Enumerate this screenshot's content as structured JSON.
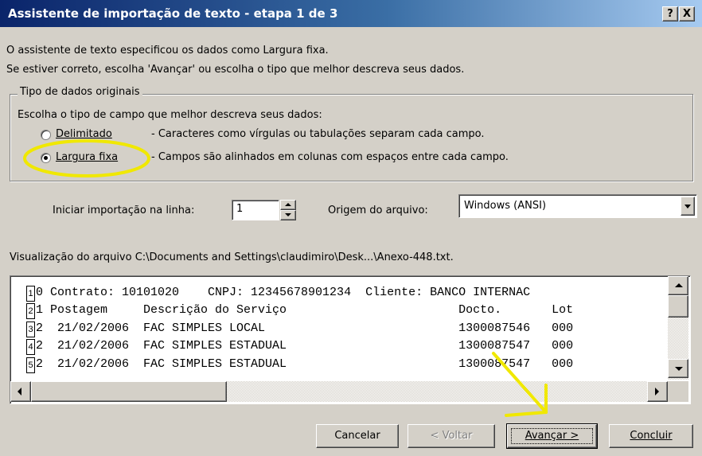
{
  "window": {
    "title": "Assistente de importação de texto - etapa 1 de 3",
    "help_btn": "?",
    "close_btn": "X"
  },
  "intro": {
    "line1": "O assistente de texto especificou os dados como Largura fixa.",
    "line2": "Se estiver correto, escolha 'Avançar' ou escolha o tipo que melhor descreva seus dados."
  },
  "group": {
    "legend": "Tipo de dados originais",
    "prompt": "Escolha o tipo de campo que melhor descreva seus dados:",
    "options": [
      {
        "label": "Delimitado",
        "desc": "- Caracteres como vírgulas ou tabulações separam cada campo.",
        "selected": false
      },
      {
        "label": "Largura fixa",
        "desc": "- Campos são alinhados em colunas com espaços entre cada campo.",
        "selected": true
      }
    ]
  },
  "start_row": {
    "label": "Iniciar importação na linha:",
    "value": "1"
  },
  "origin": {
    "label": "Origem do arquivo:",
    "value": "Windows (ANSI)"
  },
  "preview": {
    "label": "Visualização do arquivo C:\\Documents and Settings\\claudimiro\\Desk...\\Anexo-448.txt.",
    "rows": [
      {
        "num": "1",
        "text": "0 Contrato: 10101020    CNPJ: 12345678901234  Cliente: BANCO INTERNAC"
      },
      {
        "num": "2",
        "text": "1 Postagem     Descrição do Serviço                        Docto.       Lot"
      },
      {
        "num": "3",
        "text": "2  21/02/2006  FAC SIMPLES LOCAL                           1300087546   000"
      },
      {
        "num": "4",
        "text": "2  21/02/2006  FAC SIMPLES ESTADUAL                        1300087547   000"
      },
      {
        "num": "5",
        "text": "2  21/02/2006  FAC SIMPLES ESTADUAL                        1300087547   000"
      }
    ]
  },
  "buttons": {
    "cancel": "Cancelar",
    "back": "< Voltar",
    "next": "Avançar >",
    "finish": "Concluir"
  },
  "annotation_colors": {
    "ellipse": "#f0e800",
    "arrow": "#f0e800"
  }
}
